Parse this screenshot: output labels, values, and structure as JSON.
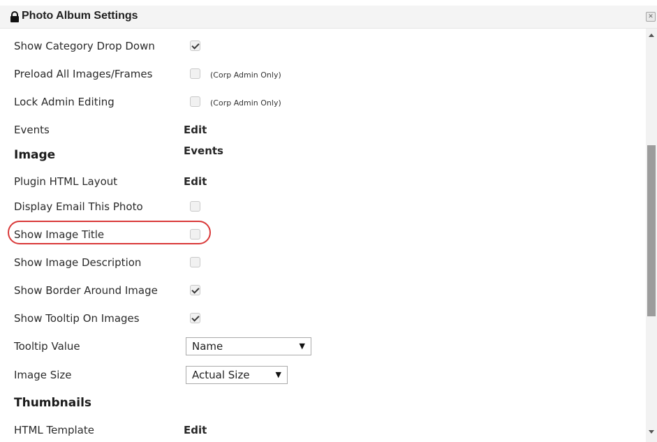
{
  "title": "Photo Album Settings",
  "close_label": "✕",
  "general": {
    "show_category_drop_down": {
      "label": "Show Category Drop Down",
      "checked": true
    },
    "preload_all_images": {
      "label": "Preload All Images/Frames",
      "checked": false,
      "note": "(Corp Admin Only)"
    },
    "lock_admin_editing": {
      "label": "Lock Admin Editing",
      "checked": false,
      "note": "(Corp Admin Only)"
    },
    "events": {
      "label": "Events",
      "link": "Edit Events"
    }
  },
  "image": {
    "heading": "Image",
    "plugin_html_layout": {
      "label": "Plugin HTML Layout",
      "link": "Edit"
    },
    "display_email_this_photo": {
      "label": "Display Email This Photo",
      "checked": false
    },
    "show_image_title": {
      "label": "Show Image Title",
      "checked": false
    },
    "show_image_description": {
      "label": "Show Image Description",
      "checked": false
    },
    "show_border_around_image": {
      "label": "Show Border Around Image",
      "checked": true
    },
    "show_tooltip_on_images": {
      "label": "Show Tooltip On Images",
      "checked": true
    },
    "tooltip_value": {
      "label": "Tooltip Value",
      "selected": "Name"
    },
    "image_size": {
      "label": "Image Size",
      "selected": "Actual Size"
    }
  },
  "thumbnails": {
    "heading": "Thumbnails",
    "html_template": {
      "label": "HTML Template",
      "link": "Edit"
    }
  },
  "colors": {
    "highlight": "#d93838",
    "titlebar": "#f4f4f4"
  },
  "icons": {
    "title": "lock-icon",
    "close": "close-icon",
    "select_arrow": "caret-down-icon"
  }
}
